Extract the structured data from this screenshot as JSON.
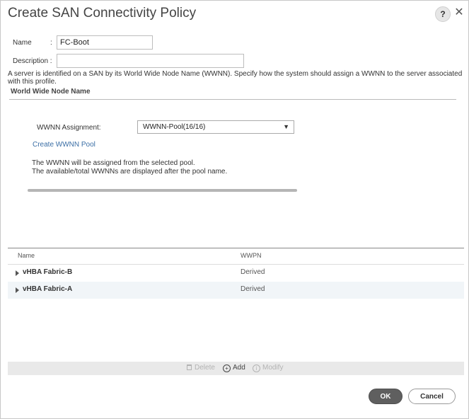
{
  "dialog": {
    "title": "Create SAN Connectivity Policy",
    "help_label": "?",
    "close_label": "✕"
  },
  "form": {
    "name_label": "Name",
    "name_colon": ":",
    "name_value": "FC-Boot",
    "description_label": "Description :",
    "description_value": ""
  },
  "info_text": "A server is identified on a SAN by its World Wide Node Name (WWNN). Specify how the system should assign a WWNN to the server associated with this profile.",
  "wwnn": {
    "section_title": "World Wide Node Name",
    "assignment_label": "WWNN Assignment:",
    "assignment_value": "WWNN-Pool(16/16)",
    "create_link": "Create WWNN Pool",
    "note_line1": "The WWNN will be assigned from the selected pool.",
    "note_line2": "The available/total WWNNs are displayed after the pool name."
  },
  "table": {
    "columns": [
      "Name",
      "WWPN"
    ],
    "rows": [
      {
        "name": "vHBA Fabric-B",
        "wwpn": "Derived"
      },
      {
        "name": "vHBA Fabric-A",
        "wwpn": "Derived"
      }
    ]
  },
  "toolbar": {
    "delete_label": "Delete",
    "add_label": "Add",
    "modify_label": "Modify"
  },
  "buttons": {
    "ok_label": "OK",
    "cancel_label": "Cancel"
  }
}
